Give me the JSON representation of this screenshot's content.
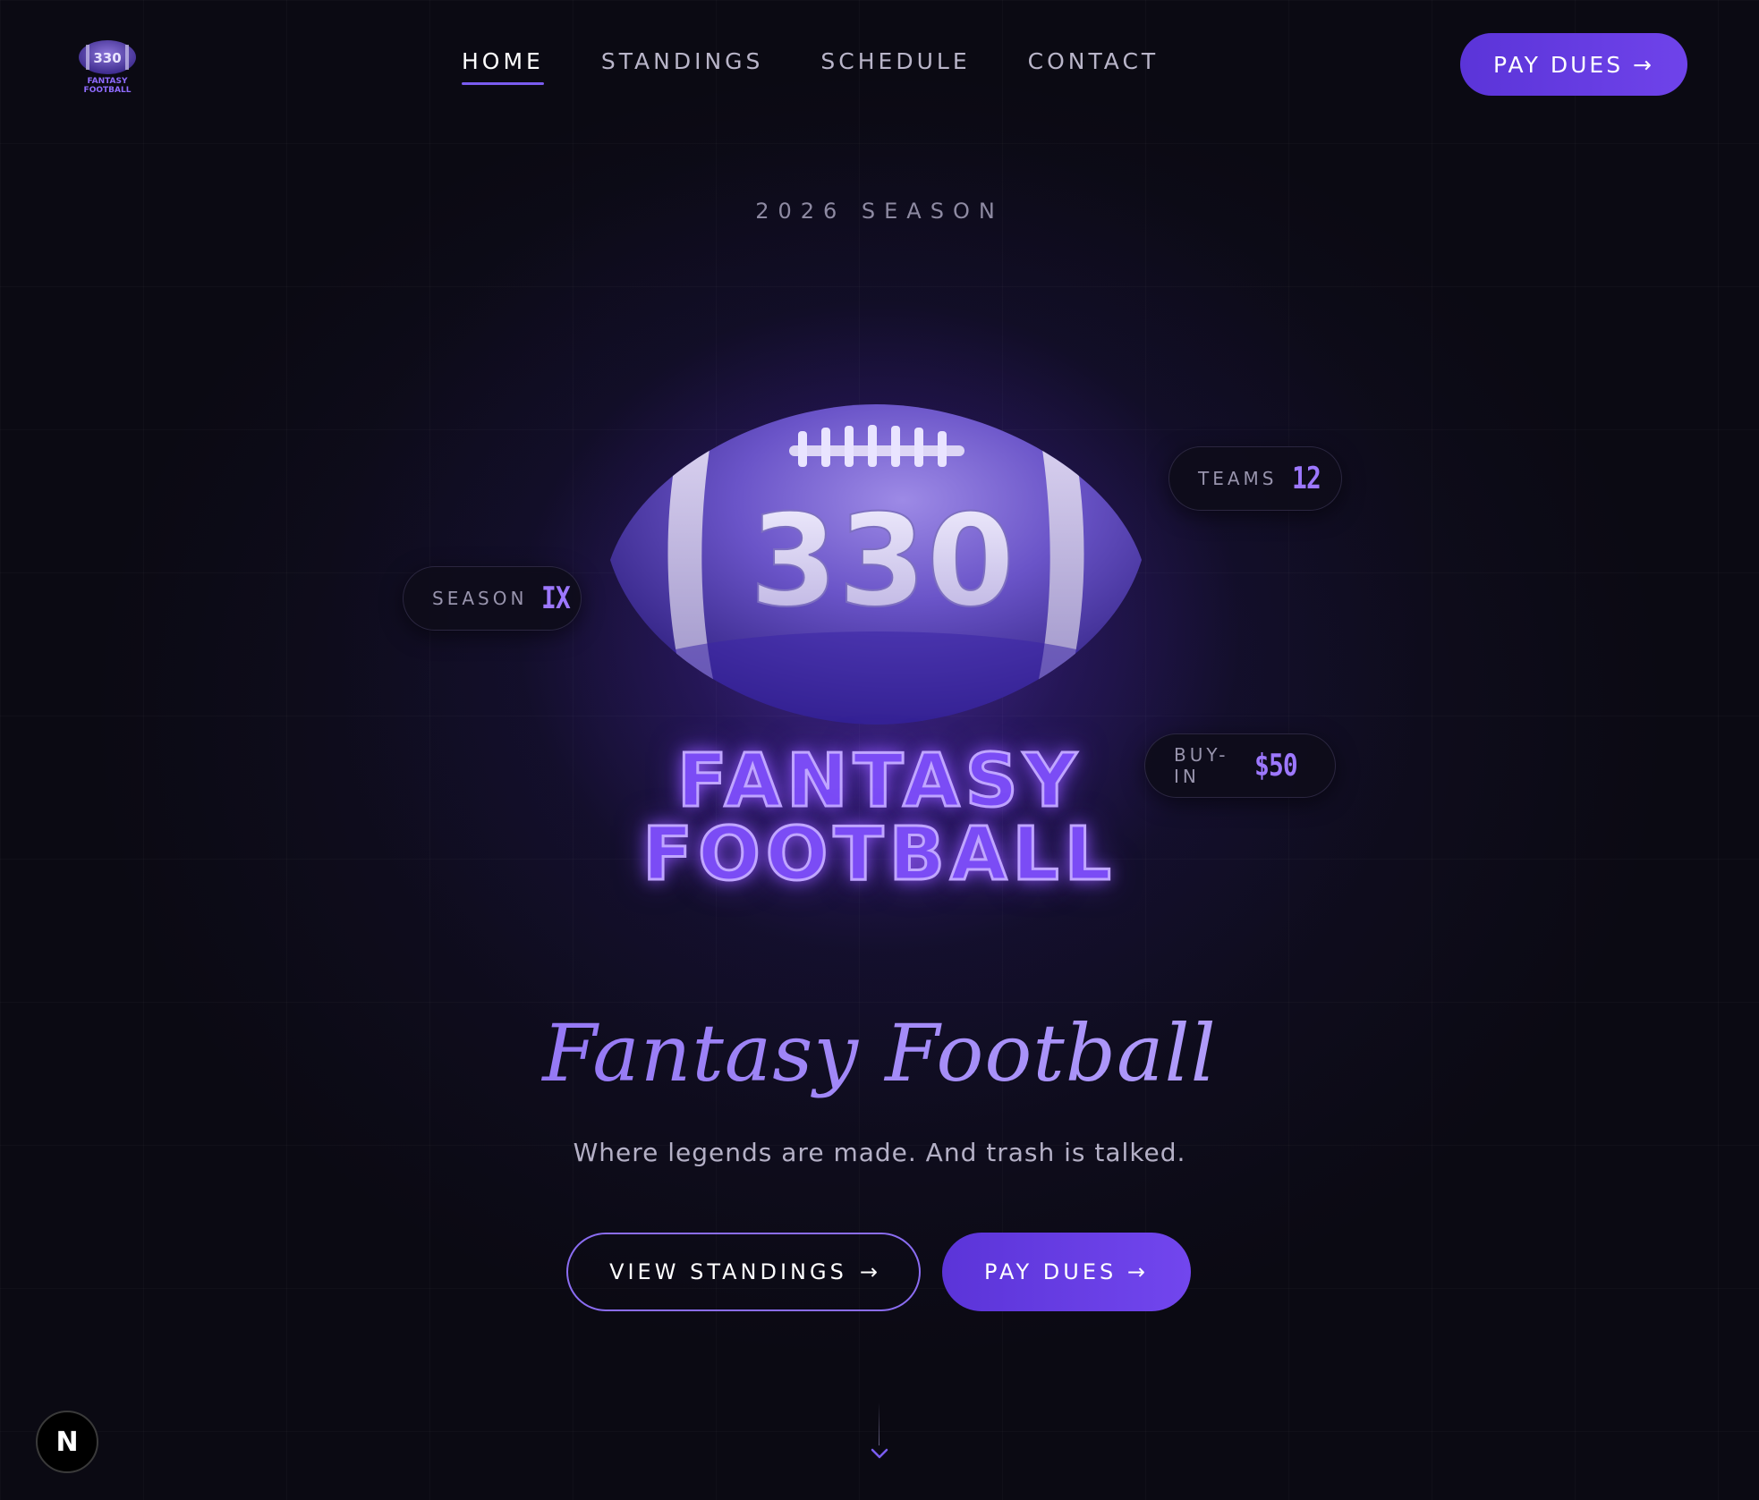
{
  "logo": {
    "number": "330",
    "line1": "FANTASY",
    "line2": "FOOTBALL"
  },
  "nav": {
    "items": [
      {
        "label": "HOME",
        "active": true
      },
      {
        "label": "STANDINGS",
        "active": false
      },
      {
        "label": "SCHEDULE",
        "active": false
      },
      {
        "label": "CONTACT",
        "active": false
      }
    ],
    "cta_label": "PAY DUES →"
  },
  "hero": {
    "eyebrow": "2026 SEASON",
    "ball_number": "330",
    "brand_line1": "FANTASY",
    "brand_line2": "FOOTBALL",
    "title": "Fantasy Football",
    "tagline": "Where legends are made. And trash is talked."
  },
  "stats": {
    "teams": {
      "label": "TEAMS",
      "value": "12"
    },
    "season": {
      "label": "SEASON",
      "value": "IX"
    },
    "buyin": {
      "label": "BUY-IN",
      "value": "$50"
    }
  },
  "actions": {
    "standings_label": "VIEW STANDINGS",
    "standings_arrow": "→",
    "dues_label": "PAY DUES →"
  },
  "badge": {
    "letter": "N"
  },
  "colors": {
    "accent": "#6f43ea",
    "accent_light": "#9d78ff",
    "background": "#0b0a13"
  }
}
